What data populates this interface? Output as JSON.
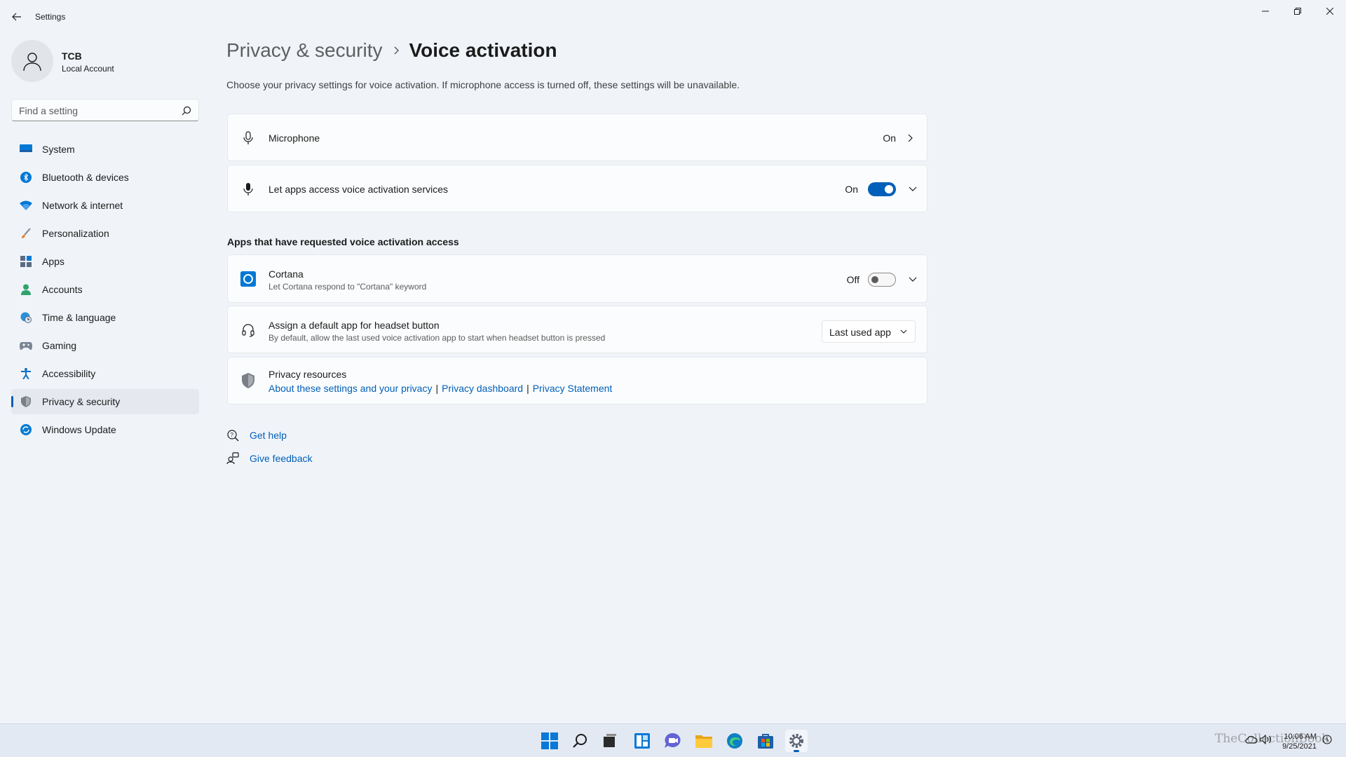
{
  "window": {
    "title": "Settings",
    "minimize_icon": "minimize-icon",
    "maximize_icon": "restore-icon",
    "close_icon": "close-icon"
  },
  "account": {
    "name": "TCB",
    "type": "Local Account"
  },
  "search": {
    "placeholder": "Find a setting",
    "value": ""
  },
  "sidebar": {
    "items": [
      {
        "label": "System",
        "icon": "system-icon",
        "color": "#0078d4"
      },
      {
        "label": "Bluetooth & devices",
        "icon": "bluetooth-icon",
        "color": "#0078d4"
      },
      {
        "label": "Network & internet",
        "icon": "wifi-icon",
        "color": "#0078d4"
      },
      {
        "label": "Personalization",
        "icon": "brush-icon",
        "color": "#e8872a"
      },
      {
        "label": "Apps",
        "icon": "apps-icon",
        "color": "#5a6a84"
      },
      {
        "label": "Accounts",
        "icon": "accounts-icon",
        "color": "#2fa36b"
      },
      {
        "label": "Time & language",
        "icon": "globe-clock-icon",
        "color": "#2a8fd8"
      },
      {
        "label": "Gaming",
        "icon": "gamepad-icon",
        "color": "#7a8595"
      },
      {
        "label": "Accessibility",
        "icon": "accessibility-icon",
        "color": "#0b6fc9"
      },
      {
        "label": "Privacy & security",
        "icon": "shield-icon",
        "color": "#7a7f87"
      },
      {
        "label": "Windows Update",
        "icon": "update-icon",
        "color": "#0a7bd1"
      }
    ],
    "active_index": 9
  },
  "main": {
    "breadcrumb_parent": "Privacy & security",
    "breadcrumb_current": "Voice activation",
    "description": "Choose your privacy settings for voice activation. If microphone access is turned off, these settings will be unavailable.",
    "microphone": {
      "title": "Microphone",
      "state": "On"
    },
    "voice_access": {
      "title": "Let apps access voice activation services",
      "state": "On",
      "toggle_on": true
    },
    "section_heading": "Apps that have requested voice activation access",
    "cortana": {
      "title": "Cortana",
      "subtitle": "Let Cortana respond to \"Cortana\" keyword",
      "state": "Off",
      "toggle_on": false
    },
    "headset": {
      "title": "Assign a default app for headset button",
      "subtitle": "By default, allow the last used voice activation app to start when headset button is pressed",
      "dropdown_value": "Last used app"
    },
    "privacy_resources": {
      "title": "Privacy resources",
      "link1": "About these settings and your privacy",
      "link2": "Privacy dashboard",
      "link3": "Privacy Statement",
      "separator": "|"
    },
    "get_help": "Get help",
    "give_feedback": "Give feedback"
  },
  "taskbar": {
    "icons": [
      "start-icon",
      "search-icon",
      "task-view-icon",
      "widgets-icon",
      "chat-icon",
      "file-explorer-icon",
      "edge-icon",
      "store-icon",
      "settings-icon"
    ],
    "time": "10:06 AM",
    "date": "9/25/2021",
    "watermark": "TheCollectionBook"
  },
  "colors": {
    "accent": "#005fb8",
    "background": "#f0f4f9",
    "card": "#fbfcfd"
  }
}
